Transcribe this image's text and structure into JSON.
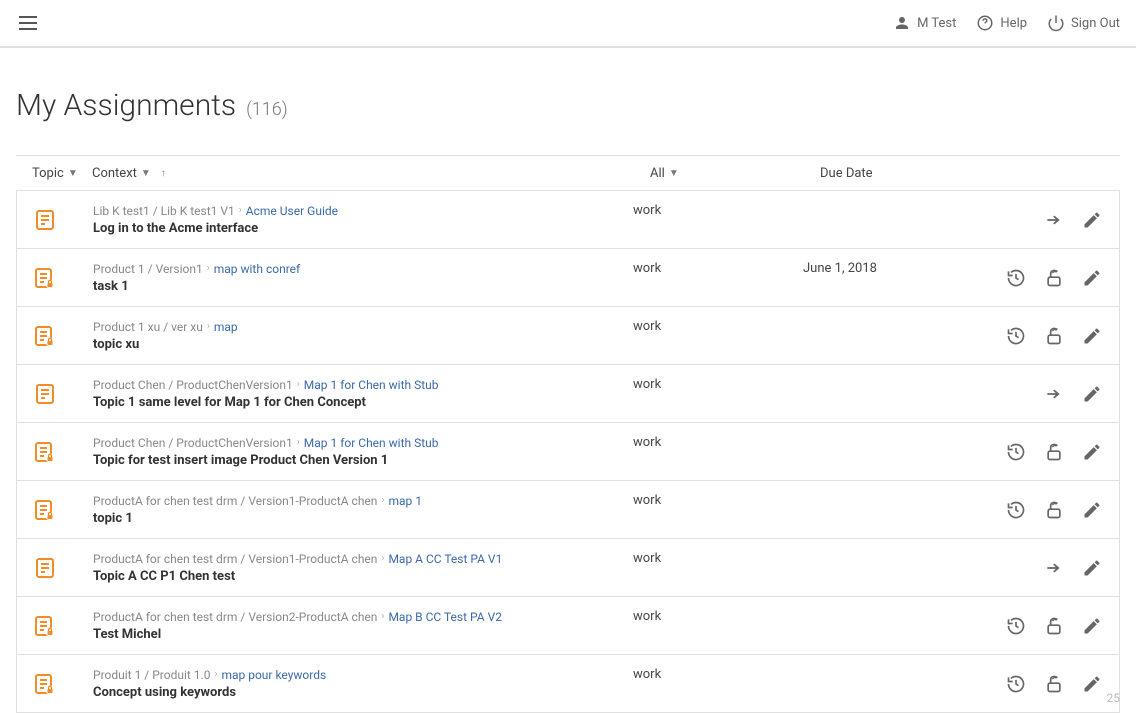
{
  "header": {
    "user_label": "M Test",
    "help_label": "Help",
    "signout_label": "Sign Out"
  },
  "page": {
    "title": "My Assignments",
    "count": "(116)",
    "footer_num": "25"
  },
  "columns": {
    "topic": "Topic",
    "context": "Context",
    "status": "All",
    "due": "Due Date"
  },
  "rows": [
    {
      "locked": false,
      "crumbs": [
        {
          "text": "Lib K test1 / Lib K test1 V1",
          "link": false
        },
        {
          "text": "Acme User Guide",
          "link": true
        }
      ],
      "title": "Log in to the Acme interface",
      "status": "work",
      "due": "",
      "actions": [
        "arrow",
        "edit"
      ]
    },
    {
      "locked": true,
      "crumbs": [
        {
          "text": "Product 1 / Version1",
          "link": false
        },
        {
          "text": "map with conref",
          "link": true
        }
      ],
      "title": "task 1",
      "status": "work",
      "due": "June 1, 2018",
      "actions": [
        "history",
        "unlock",
        "edit"
      ]
    },
    {
      "locked": true,
      "crumbs": [
        {
          "text": "Product 1 xu / ver xu",
          "link": false
        },
        {
          "text": "map",
          "link": true
        }
      ],
      "title": "topic xu",
      "status": "work",
      "due": "",
      "actions": [
        "history",
        "unlock",
        "edit"
      ]
    },
    {
      "locked": false,
      "crumbs": [
        {
          "text": "Product Chen / ProductChenVersion1",
          "link": false
        },
        {
          "text": "Map 1 for Chen with Stub",
          "link": true
        }
      ],
      "title": "Topic 1 same level for Map 1 for Chen Concept",
      "status": "work",
      "due": "",
      "actions": [
        "arrow",
        "edit"
      ]
    },
    {
      "locked": true,
      "crumbs": [
        {
          "text": "Product Chen / ProductChenVersion1",
          "link": false
        },
        {
          "text": "Map 1 for Chen with Stub",
          "link": true
        }
      ],
      "title": "Topic for test insert image Product Chen Version 1",
      "status": "work",
      "due": "",
      "actions": [
        "history",
        "unlock",
        "edit"
      ]
    },
    {
      "locked": true,
      "crumbs": [
        {
          "text": "ProductA for chen test drm / Version1-ProductA chen",
          "link": false
        },
        {
          "text": "map 1",
          "link": true
        }
      ],
      "title": "topic 1",
      "status": "work",
      "due": "",
      "actions": [
        "history",
        "unlock",
        "edit"
      ]
    },
    {
      "locked": false,
      "crumbs": [
        {
          "text": "ProductA for chen test drm / Version1-ProductA chen",
          "link": false
        },
        {
          "text": "Map A CC Test PA V1",
          "link": true
        }
      ],
      "title": "Topic A CC P1 Chen test",
      "status": "work",
      "due": "",
      "actions": [
        "arrow",
        "edit"
      ]
    },
    {
      "locked": true,
      "crumbs": [
        {
          "text": "ProductA for chen test drm / Version2-ProductA chen",
          "link": false
        },
        {
          "text": "Map B CC Test PA V2",
          "link": true
        }
      ],
      "title": "Test Michel",
      "status": "work",
      "due": "",
      "actions": [
        "history",
        "unlock",
        "edit"
      ]
    },
    {
      "locked": true,
      "crumbs": [
        {
          "text": "Produit 1 / Produit 1.0",
          "link": false
        },
        {
          "text": "map pour keywords",
          "link": true
        }
      ],
      "title": "Concept using keywords",
      "status": "work",
      "due": "",
      "actions": [
        "history",
        "unlock",
        "edit"
      ]
    }
  ]
}
